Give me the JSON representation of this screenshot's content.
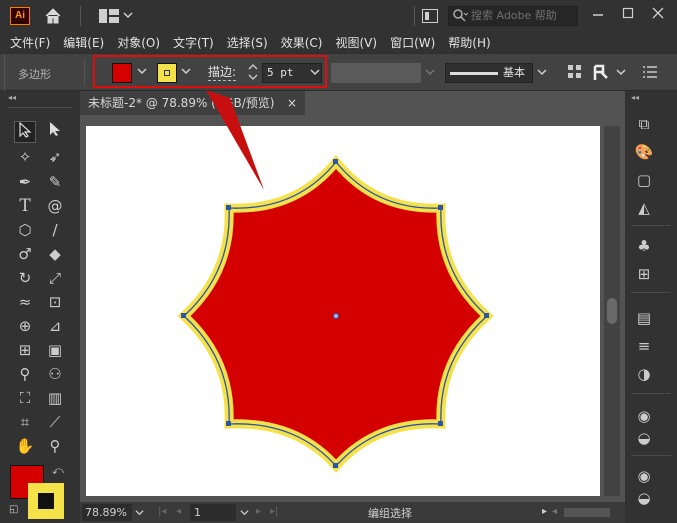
{
  "titlebar": {
    "app_logo": "Ai",
    "search_placeholder": "搜索 Adobe 帮助",
    "icons": [
      "home-icon",
      "workspace-grid-icon",
      "chevron-down-icon",
      "screen-mode-icon",
      "search-icon",
      "minimize-icon",
      "maximize-icon",
      "close-icon"
    ]
  },
  "menubar": {
    "items": [
      {
        "label": "文件(F)"
      },
      {
        "label": "编辑(E)"
      },
      {
        "label": "对象(O)"
      },
      {
        "label": "文字(T)"
      },
      {
        "label": "选择(S)"
      },
      {
        "label": "效果(C)"
      },
      {
        "label": "视图(V)"
      },
      {
        "label": "窗口(W)"
      },
      {
        "label": "帮助(H)"
      }
    ]
  },
  "controlbar": {
    "tool_name": "多边形",
    "fill_color": "#d40000",
    "stroke_color": "#f5e24a",
    "stroke_label": "描边",
    "stroke_colon": ":",
    "stroke_value": "5 pt",
    "profile_label": "基本",
    "highlight_color": "#e10c0c"
  },
  "document": {
    "tab_title": "未标题-2* @ 78.89% (RGB/预览)",
    "tab_close": "×",
    "zoom": "78.89%",
    "artboard_number": "1",
    "status_text": "编组选择"
  },
  "artwork": {
    "fill": "#d40000",
    "stroke": "#f5e24a",
    "outline": "#2a55a8"
  },
  "toolbox": {
    "fill_swatch": "#d40000",
    "stroke_swatch": "#f5e24a"
  }
}
